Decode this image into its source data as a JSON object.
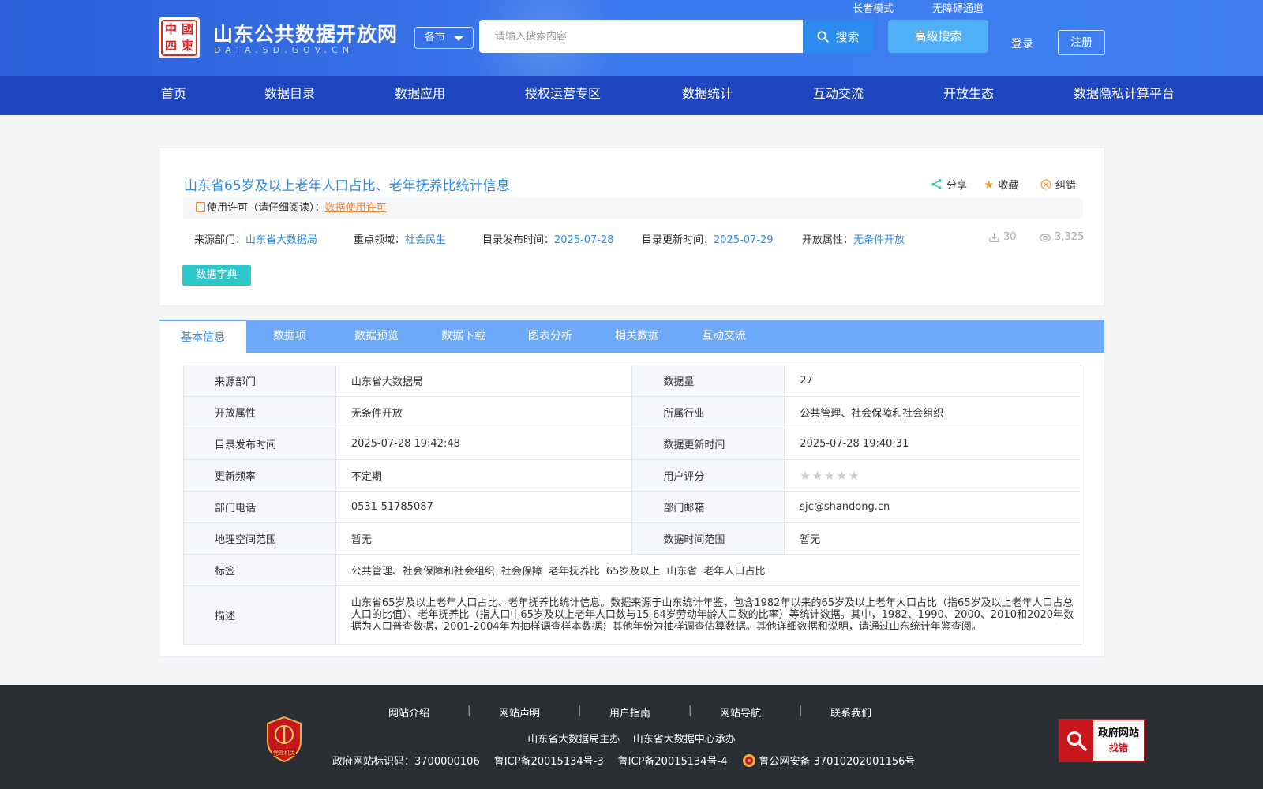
{
  "header": {
    "seal_chars": [
      "中",
      "國",
      "四",
      "東"
    ],
    "site_title": "山东公共数据开放网",
    "site_domain": "DATA.SD.GOV.CN",
    "city_select": "各市",
    "search_placeholder": "请输入搜索内容",
    "search_label": "搜索",
    "advanced_search_label": "高级搜索",
    "elder_mode_label": "长者模式",
    "barrier_free_label": "无障碍通道",
    "login_label": "登录",
    "register_label": "注册"
  },
  "nav": {
    "items": [
      {
        "label": "首页"
      },
      {
        "label": "数据目录"
      },
      {
        "label": "数据应用"
      },
      {
        "label": "授权运营专区"
      },
      {
        "label": "数据统计"
      },
      {
        "label": "互动交流"
      },
      {
        "label": "开放生态"
      },
      {
        "label": "数据隐私计算平台"
      }
    ]
  },
  "dataset": {
    "title": "山东省65岁及以上老年人口占比、老年抚养比统计信息",
    "actions": {
      "share": "分享",
      "favorite": "收藏",
      "report": "纠错"
    },
    "license_prefix": "使用许可（请仔细阅读）：",
    "license_link": "数据使用许可",
    "meta": {
      "source_label": "来源部门：",
      "source_value": "山东省大数据局",
      "field_label": "重点领域：",
      "field_value": "社会民生",
      "publish_label": "目录发布时间：",
      "publish_value": "2025-07-28",
      "update_label": "目录更新时间：",
      "update_value": "2025-07-29",
      "open_label": "开放属性：",
      "open_value": "无条件开放"
    },
    "downloads": "30",
    "views": "3,325",
    "dict_button": "数据字典"
  },
  "tabs": [
    {
      "label": "基本信息",
      "active": true
    },
    {
      "label": "数据项"
    },
    {
      "label": "数据预览"
    },
    {
      "label": "数据下载"
    },
    {
      "label": "图表分析"
    },
    {
      "label": "相关数据"
    },
    {
      "label": "互动交流"
    }
  ],
  "info": {
    "source_dept_label": "来源部门",
    "source_dept_value": "山东省大数据局",
    "data_volume_label": "数据量",
    "data_volume_value": "27",
    "open_attr_label": "开放属性",
    "open_attr_value": "无条件开放",
    "industry_label": "所属行业",
    "industry_value": "公共管理、社会保障和社会组织",
    "catalog_publish_label": "目录发布时间",
    "catalog_publish_value": "2025-07-28 19:42:48",
    "data_update_label": "数据更新时间",
    "data_update_value": "2025-07-28 19:40:31",
    "frequency_label": "更新频率",
    "frequency_value": "不定期",
    "rating_label": "用户评分",
    "rating_value": 0,
    "phone_label": "部门电话",
    "phone_value": "0531-51785087",
    "email_label": "部门邮箱",
    "email_value": "sjc@shandong.cn",
    "geo_label": "地理空间范围",
    "geo_value": "暂无",
    "time_range_label": "数据时间范围",
    "time_range_value": "暂无",
    "tags_label": "标签",
    "tags": [
      "公共管理、社会保障和社会组织",
      "社会保障",
      "老年抚养比",
      "65岁及以上",
      "山东省",
      "老年人口占比"
    ],
    "desc_label": "描述",
    "desc_value": "山东省65岁及以上老年人口占比、老年抚养比统计信息。数据来源于山东统计年鉴，包含1982年以来的65岁及以上老年人口占比（指65岁及以上老年人口占总人口的比值）、老年抚养比（指人口中65岁及以上老年人口数与15-64岁劳动年龄人口数的比率）等统计数据。其中，1982、1990、2000、2010和2020年数据为人口普查数据，2001-2004年为抽样调查样本数据；其他年份为抽样调查估算数据。其他详细数据和说明，请通过山东统计年鉴查阅。"
  },
  "footer": {
    "links": [
      "网站介绍",
      "网站声明",
      "用户指南",
      "网站导航",
      "联系我们"
    ],
    "separator": "|",
    "host": "山东省大数据局主办",
    "organizer": "山东省大数据中心承办",
    "site_id": "政府网站标识码：3700000106",
    "icp1": "鲁ICP备20015134号-3",
    "icp2": "鲁ICP备20015134号-4",
    "police": "鲁公网安备 37010202001156号",
    "party_badge": "党政机关",
    "gov_badge_line1": "政府网站",
    "gov_badge_line2": "找错"
  }
}
